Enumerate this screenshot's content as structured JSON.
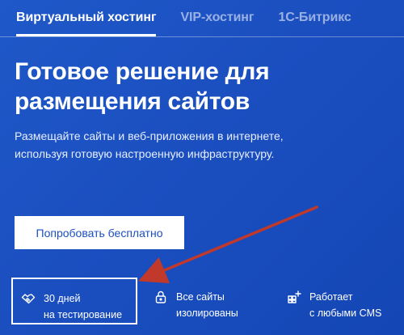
{
  "tabs": [
    {
      "label": "Виртуальный хостинг",
      "active": true
    },
    {
      "label": "VIP-хостинг",
      "active": false
    },
    {
      "label": "1С-Битрикс",
      "active": false
    }
  ],
  "hero": {
    "title_line1": "Готовое решение для",
    "title_line2": "размещения сайтов",
    "subtitle_line1": "Размещайте сайты и веб-приложения в интернете,",
    "subtitle_line2": "используя готовую настроенную инфраструктуру."
  },
  "cta": {
    "label": "Попробовать бесплатно"
  },
  "features": [
    {
      "icon": "handshake-icon",
      "line1": "30 дней",
      "line2": "на тестирование"
    },
    {
      "icon": "lock-icon",
      "line1": "Все сайты",
      "line2": "изолированы"
    },
    {
      "icon": "add-widget-icon",
      "line1": "Работает",
      "line2": "с любыми CMS"
    }
  ],
  "colors": {
    "background": "#1b4fc0",
    "annotation_arrow": "#c0392b",
    "cta_text": "#1b4fc0"
  }
}
